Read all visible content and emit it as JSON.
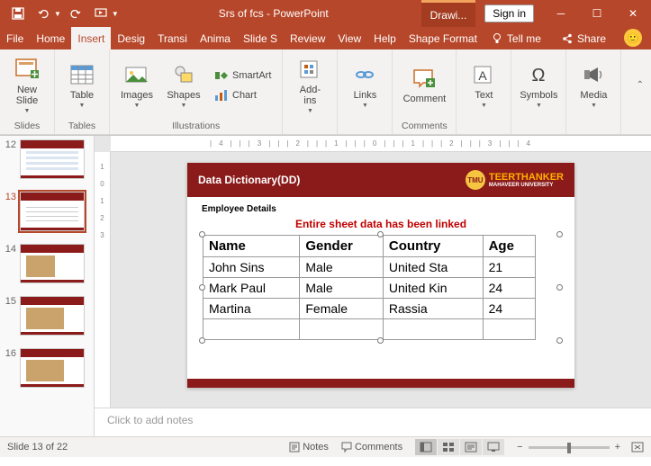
{
  "titlebar": {
    "document_title": "Srs of fcs  -  PowerPoint",
    "contextual_tab": "Drawi...",
    "signin": "Sign in"
  },
  "tabs": {
    "file": "File",
    "home": "Home",
    "insert": "Insert",
    "design": "Desig",
    "transitions": "Transi",
    "animations": "Anima",
    "slideshow": "Slide S",
    "review": "Review",
    "view": "View",
    "help": "Help",
    "shape_format": "Shape Format",
    "tellme": "Tell me",
    "share": "Share"
  },
  "ribbon": {
    "slides_group": "Slides",
    "tables_group": "Tables",
    "illustrations_group": "Illustrations",
    "comments_group": "Comments",
    "new_slide": "New\nSlide",
    "table": "Table",
    "images": "Images",
    "shapes": "Shapes",
    "smartart": "SmartArt",
    "chart": "Chart",
    "addins": "Add-\nins",
    "links": "Links",
    "comment": "Comment",
    "text": "Text",
    "symbols": "Symbols",
    "media": "Media"
  },
  "thumbs": [
    "12",
    "13",
    "14",
    "15",
    "16"
  ],
  "slide": {
    "header_title": "Data Dictionary(DD)",
    "logo_main": "TEERTHANKER",
    "logo_sub": "MAHAVEER UNIVERSITY",
    "section": "Employee Details",
    "linked_note": "Entire sheet data has been linked",
    "table": {
      "headers": [
        "Name",
        "Gender",
        "Country",
        "Age"
      ],
      "rows": [
        [
          "John Sins",
          "Male",
          "United Sta",
          "21"
        ],
        [
          "Mark Paul",
          "Male",
          "United Kin",
          "24"
        ],
        [
          "Martina",
          "Female",
          "Rassia",
          "24"
        ]
      ]
    }
  },
  "notes": {
    "placeholder": "Click to add notes"
  },
  "status": {
    "slide_of": "Slide 13 of 22",
    "notes_btn": "Notes",
    "comments_btn": "Comments",
    "zoom_pct": "+"
  }
}
